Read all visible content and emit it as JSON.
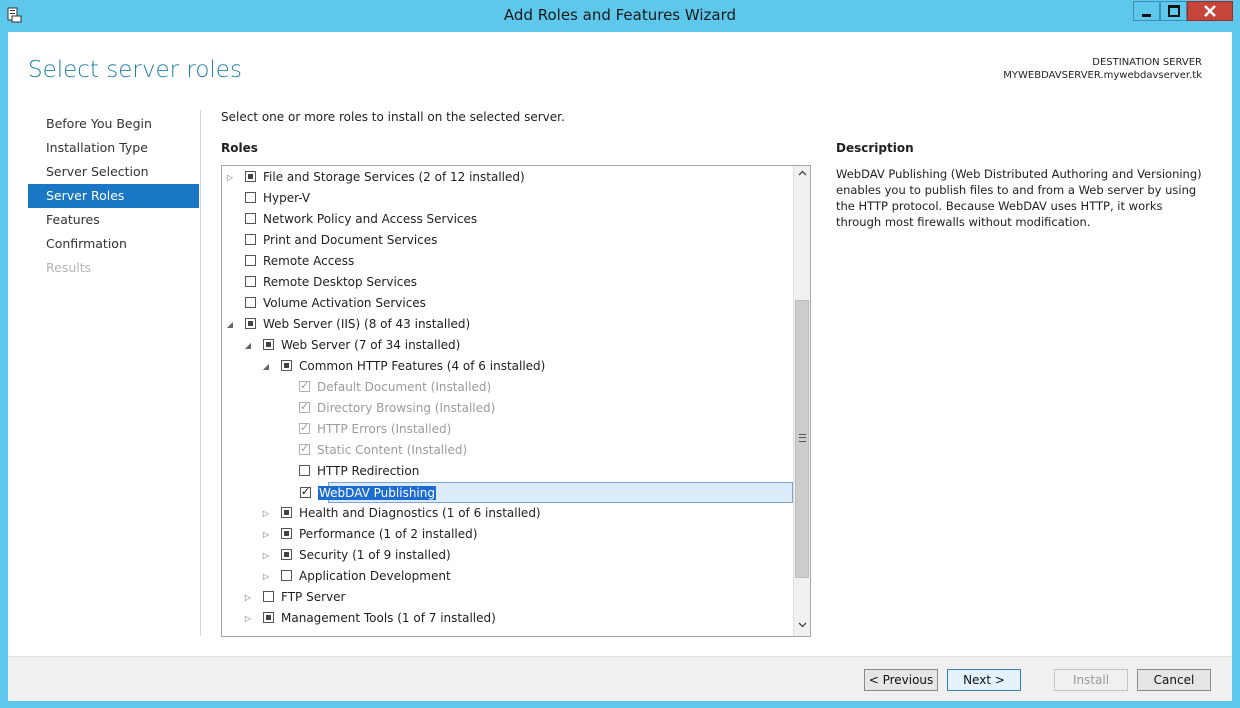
{
  "window": {
    "title": "Add Roles and Features Wizard"
  },
  "page": {
    "title": "Select server roles",
    "destination_label": "DESTINATION SERVER",
    "destination_value": "MYWEBDAVSERVER.mywebdavserver.tk"
  },
  "nav": {
    "items": [
      {
        "label": "Before You Begin",
        "state": "normal"
      },
      {
        "label": "Installation Type",
        "state": "normal"
      },
      {
        "label": "Server Selection",
        "state": "normal"
      },
      {
        "label": "Server Roles",
        "state": "active"
      },
      {
        "label": "Features",
        "state": "normal"
      },
      {
        "label": "Confirmation",
        "state": "normal"
      },
      {
        "label": "Results",
        "state": "disabled"
      }
    ]
  },
  "main": {
    "instruction": "Select one or more roles to install on the selected server.",
    "roles_label": "Roles",
    "roles": [
      {
        "label": "File and Storage Services (2 of 12 installed)",
        "level": 0,
        "expander": "collapsed",
        "check": "partial"
      },
      {
        "label": "Hyper-V",
        "level": 0,
        "expander": "none",
        "check": "unchecked"
      },
      {
        "label": "Network Policy and Access Services",
        "level": 0,
        "expander": "none",
        "check": "unchecked"
      },
      {
        "label": "Print and Document Services",
        "level": 0,
        "expander": "none",
        "check": "unchecked"
      },
      {
        "label": "Remote Access",
        "level": 0,
        "expander": "none",
        "check": "unchecked"
      },
      {
        "label": "Remote Desktop Services",
        "level": 0,
        "expander": "none",
        "check": "unchecked"
      },
      {
        "label": "Volume Activation Services",
        "level": 0,
        "expander": "none",
        "check": "unchecked"
      },
      {
        "label": "Web Server (IIS) (8 of 43 installed)",
        "level": 0,
        "expander": "expanded",
        "check": "partial"
      },
      {
        "label": "Web Server (7 of 34 installed)",
        "level": 1,
        "expander": "expanded",
        "check": "partial"
      },
      {
        "label": "Common HTTP Features (4 of 6 installed)",
        "level": 2,
        "expander": "expanded",
        "check": "partial"
      },
      {
        "label": "Default Document (Installed)",
        "level": 3,
        "expander": "none",
        "check": "checked-disabled"
      },
      {
        "label": "Directory Browsing (Installed)",
        "level": 3,
        "expander": "none",
        "check": "checked-disabled"
      },
      {
        "label": "HTTP Errors (Installed)",
        "level": 3,
        "expander": "none",
        "check": "checked-disabled"
      },
      {
        "label": "Static Content (Installed)",
        "level": 3,
        "expander": "none",
        "check": "checked-disabled"
      },
      {
        "label": "HTTP Redirection",
        "level": 3,
        "expander": "none",
        "check": "unchecked"
      },
      {
        "label": "WebDAV Publishing",
        "level": 3,
        "expander": "none",
        "check": "checked",
        "selected": true
      },
      {
        "label": "Health and Diagnostics (1 of 6 installed)",
        "level": 2,
        "expander": "collapsed",
        "check": "partial"
      },
      {
        "label": "Performance (1 of 2 installed)",
        "level": 2,
        "expander": "collapsed",
        "check": "partial"
      },
      {
        "label": "Security (1 of 9 installed)",
        "level": 2,
        "expander": "collapsed",
        "check": "partial"
      },
      {
        "label": "Application Development",
        "level": 2,
        "expander": "collapsed",
        "check": "unchecked"
      },
      {
        "label": "FTP Server",
        "level": 1,
        "expander": "collapsed",
        "check": "unchecked"
      },
      {
        "label": "Management Tools (1 of 7 installed)",
        "level": 1,
        "expander": "collapsed",
        "check": "partial"
      }
    ]
  },
  "description": {
    "label": "Description",
    "text": "WebDAV Publishing (Web Distributed Authoring and Versioning) enables you to publish files to and from a Web server by using the HTTP protocol. Because WebDAV uses HTTP, it works through most firewalls without modification."
  },
  "footer": {
    "previous_label": "< Previous",
    "next_label": "Next >",
    "install_label": "Install",
    "cancel_label": "Cancel"
  },
  "colors": {
    "titlebar": "#5ec8ec",
    "accent": "#1a77c5",
    "page_title": "#1f7fa6",
    "selection_text_bg": "#1c6cd4"
  }
}
